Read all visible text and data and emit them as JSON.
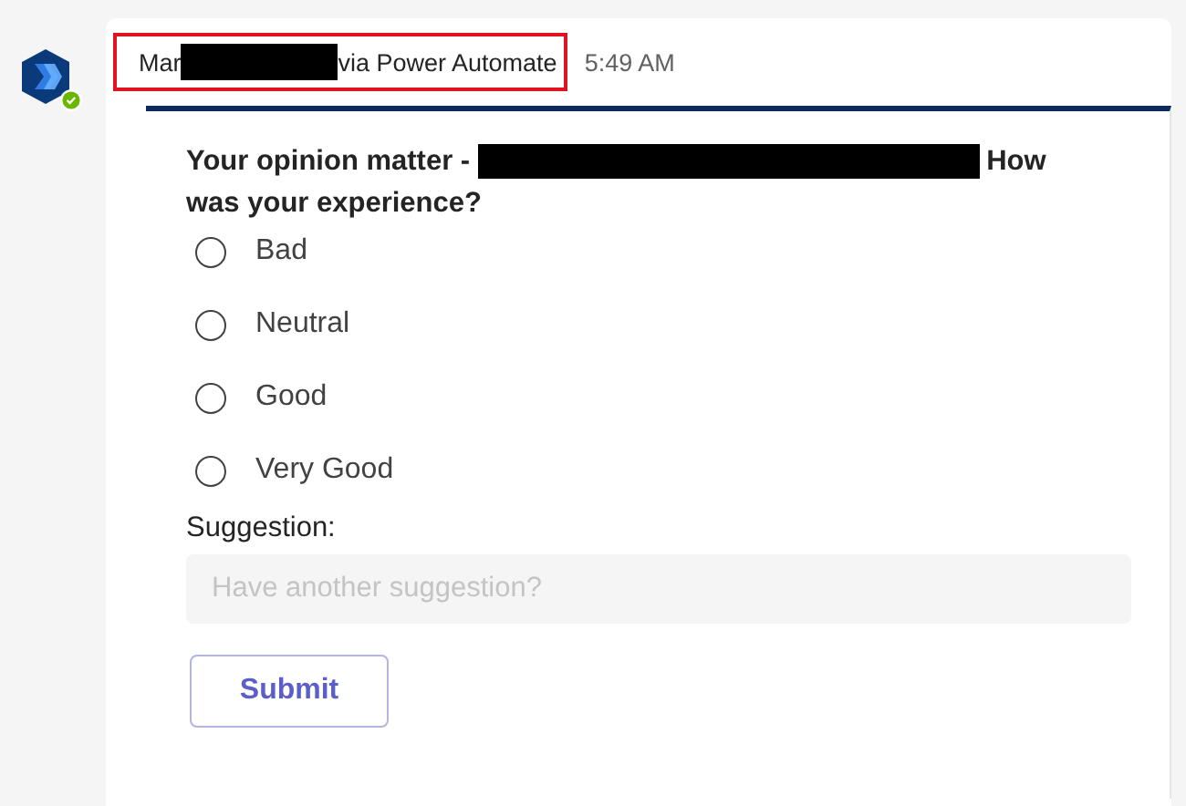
{
  "message": {
    "sender_prefix": "Mar",
    "sender_suffix": "via Power Automate",
    "highlighted": true,
    "time": "5:49 AM"
  },
  "card": {
    "question_start": "Your opinion matter -",
    "question_end": "How",
    "question_line_2": "was your experience?",
    "options": [
      {
        "label": "Bad",
        "selected": false
      },
      {
        "label": "Neutral",
        "selected": false
      },
      {
        "label": "Good",
        "selected": false
      },
      {
        "label": "Very Good",
        "selected": false
      }
    ],
    "suggestion_label": "Suggestion:",
    "suggestion_placeholder": "Have another suggestion?",
    "submit": "Submit"
  }
}
